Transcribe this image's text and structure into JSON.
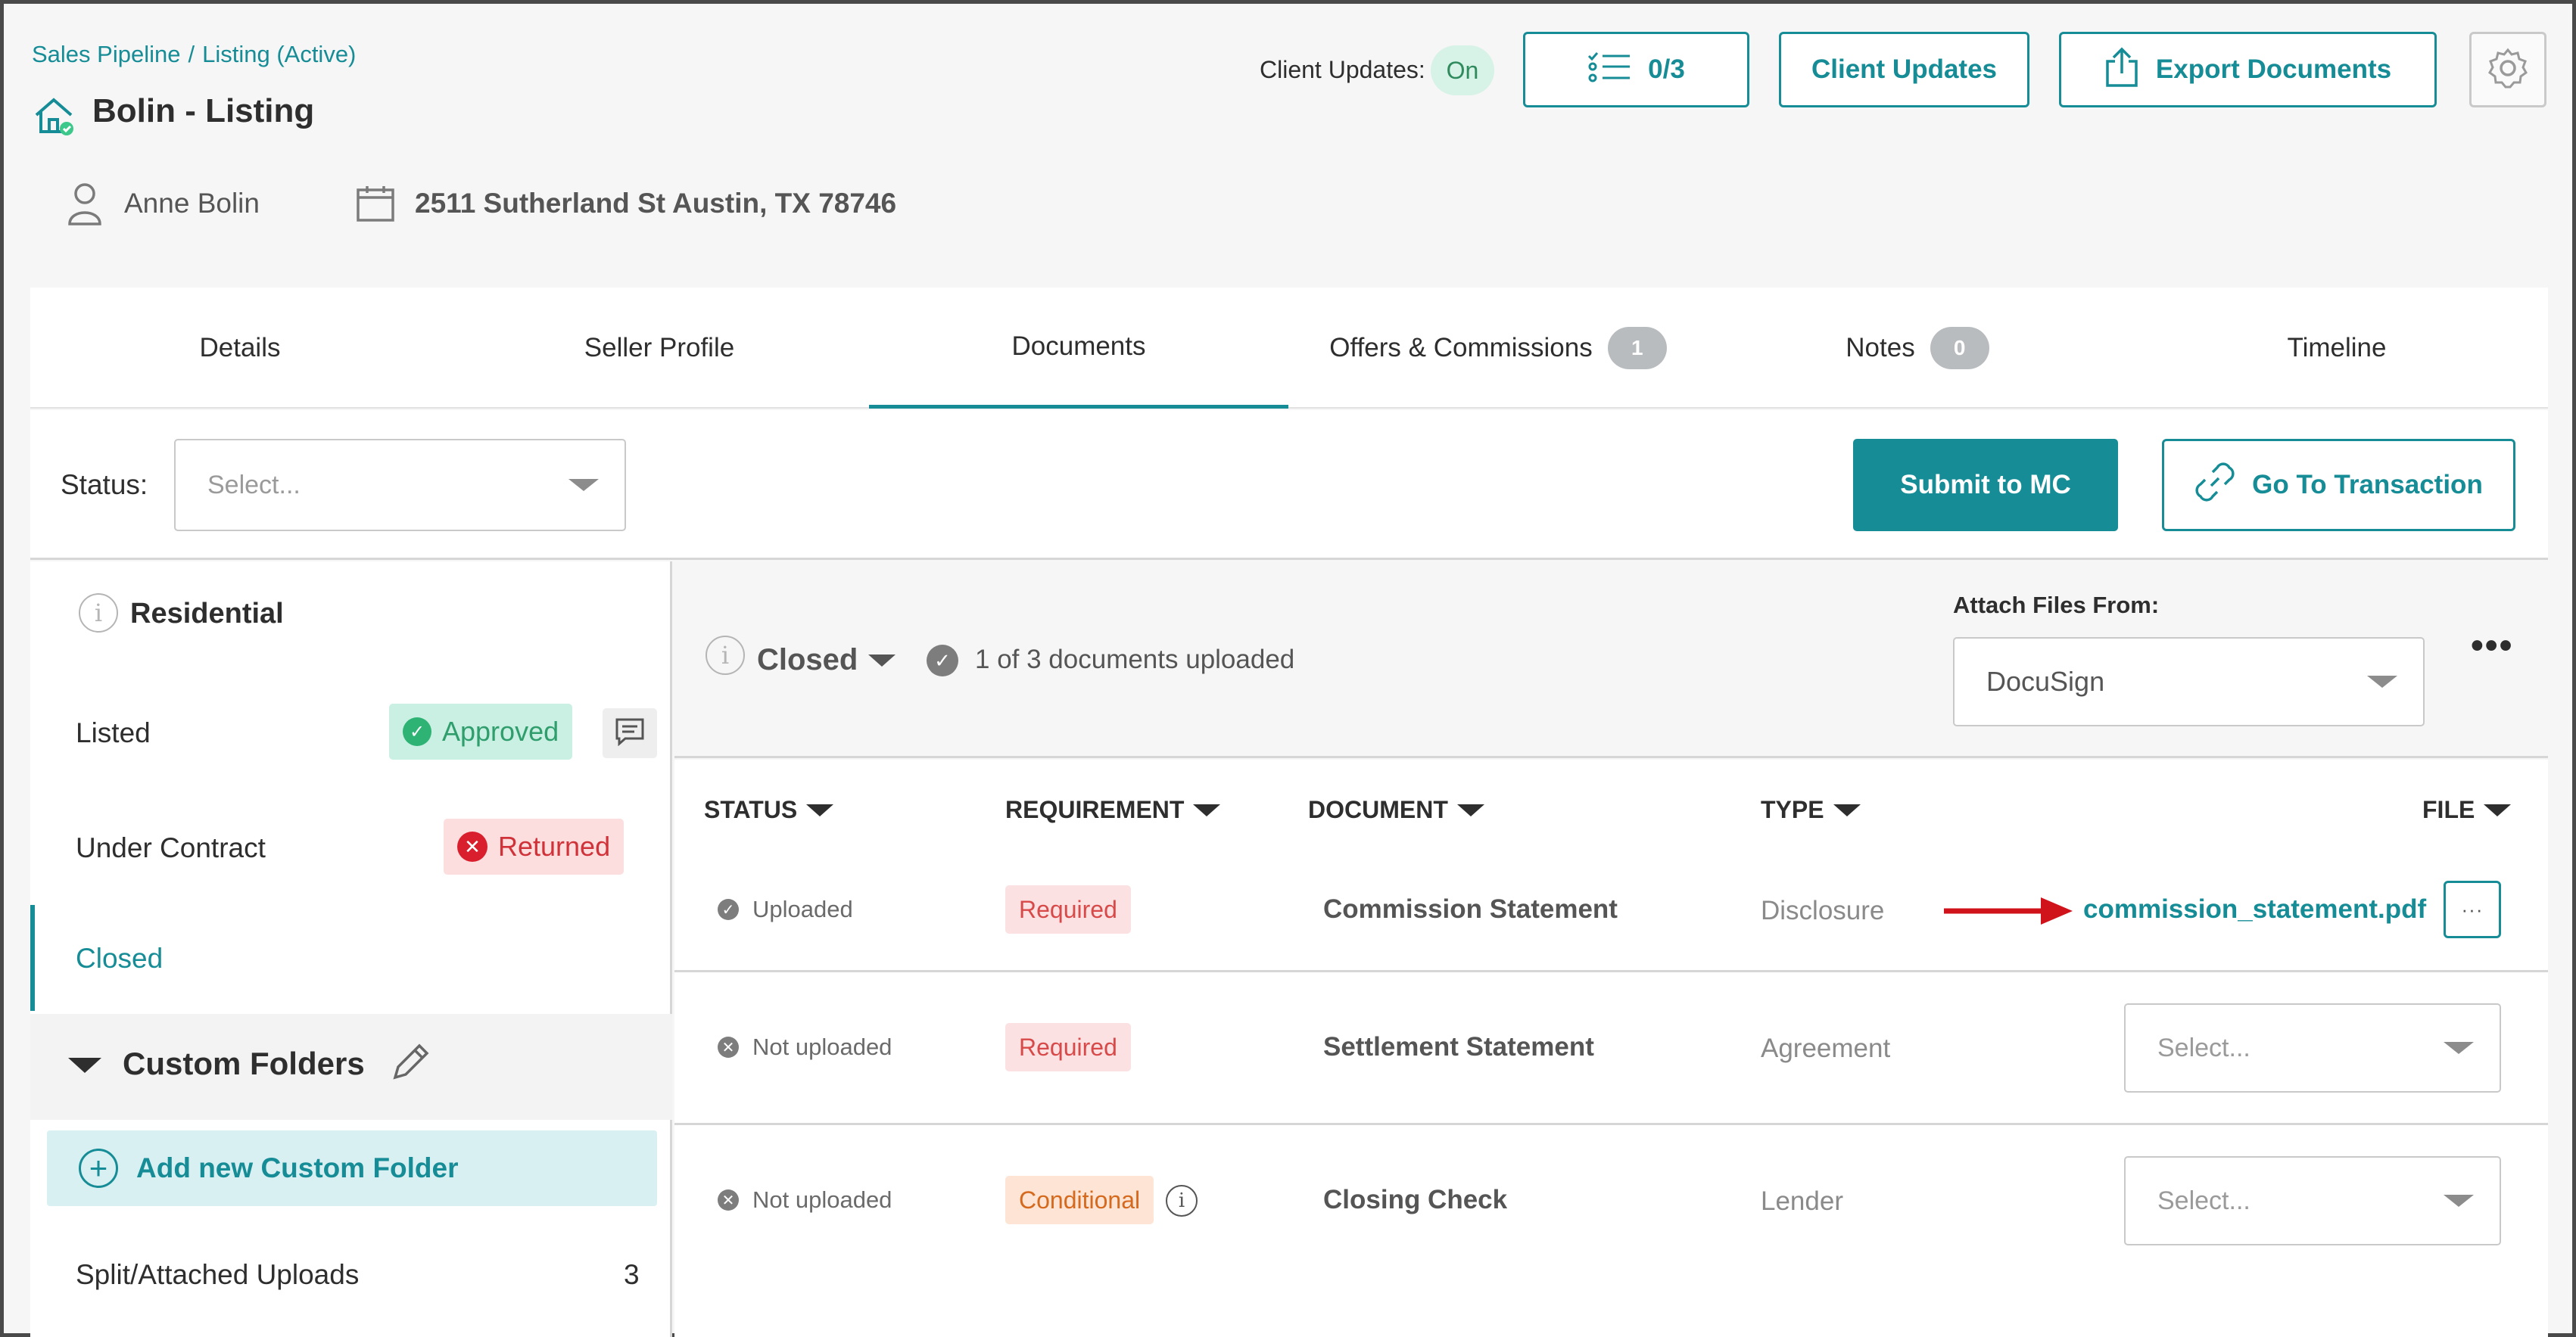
{
  "breadcrumb": {
    "pipeline": "Sales Pipeline",
    "separator": "/",
    "listing": "Listing (Active)"
  },
  "page_title": "Bolin - Listing",
  "client": {
    "name": "Anne Bolin",
    "address": "2511 Sutherland St Austin, TX 78746"
  },
  "header": {
    "client_updates_label": "Client Updates:",
    "client_updates_state": "On",
    "checklist_count": "0/3",
    "client_updates_button": "Client Updates",
    "export_button": "Export Documents"
  },
  "tabs": [
    {
      "label": "Details"
    },
    {
      "label": "Seller Profile"
    },
    {
      "label": "Documents",
      "active": true
    },
    {
      "label": "Offers & Commissions",
      "count": "1"
    },
    {
      "label": "Notes",
      "count": "0"
    },
    {
      "label": "Timeline"
    }
  ],
  "filter": {
    "status_label": "Status:",
    "status_placeholder": "Select..."
  },
  "actions": {
    "submit": "Submit to MC",
    "go_to": "Go To Transaction"
  },
  "sidebar": {
    "group_title": "Residential",
    "stages": [
      {
        "label": "Listed",
        "badge": "Approved"
      },
      {
        "label": "Under Contract",
        "badge": "Returned"
      },
      {
        "label": "Closed"
      }
    ],
    "custom_folders_title": "Custom Folders",
    "add_folder": "Add new Custom Folder",
    "split_uploads": {
      "label": "Split/Attached Uploads",
      "count": "3"
    }
  },
  "panel": {
    "stage": "Closed",
    "upload_summary": "1 of 3 documents uploaded",
    "attach_label": "Attach Files From:",
    "attach_source": "DocuSign"
  },
  "table": {
    "headers": [
      "STATUS",
      "REQUIREMENT",
      "DOCUMENT",
      "TYPE",
      "FILE"
    ],
    "rows": [
      {
        "status": "Uploaded",
        "requirement": "Required",
        "document": "Commission Statement",
        "type": "Disclosure",
        "file": "commission_statement.pdf"
      },
      {
        "status": "Not uploaded",
        "requirement": "Required",
        "document": "Settlement Statement",
        "type": "Agreement",
        "file_select": "Select..."
      },
      {
        "status": "Not uploaded",
        "requirement": "Conditional",
        "document": "Closing Check",
        "type": "Lender",
        "file_select": "Select..."
      }
    ]
  },
  "colors": {
    "accent": "#168c96",
    "approved_bg": "#c9f0e3",
    "returned_bg": "#fcdede",
    "annotation_arrow": "#d0121b"
  }
}
